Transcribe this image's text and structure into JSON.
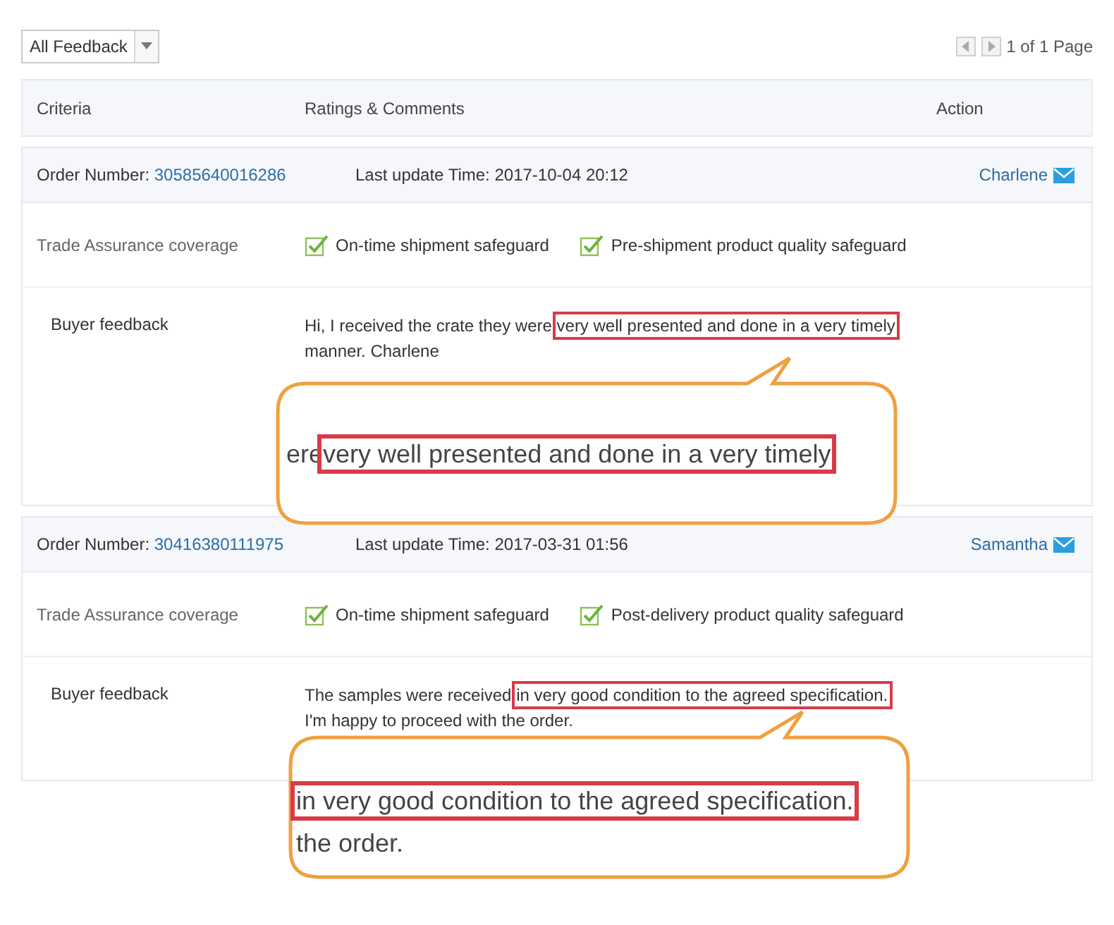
{
  "filter": {
    "label": "All Feedback"
  },
  "pager": {
    "text": "1 of 1 Page"
  },
  "table": {
    "columns": [
      "Criteria",
      "Ratings & Comments",
      "Action"
    ],
    "orders": [
      {
        "order_label": "Order Number:",
        "order_number": "30585640016286",
        "update_label": "Last update Time:",
        "update_time": "2017-10-04 20:12",
        "buyer": "Charlene",
        "coverage_label": "Trade Assurance coverage",
        "safeguards": [
          {
            "label": "On-time shipment safeguard",
            "checked": true
          },
          {
            "label": "Pre-shipment product quality safeguard",
            "checked": true
          }
        ],
        "feedback_label": "Buyer feedback",
        "feedback": {
          "before": "Hi, I received the crate  they were",
          "highlight": "very well presented and done in a very timely",
          "second_line": "manner. Charlene"
        }
      },
      {
        "order_label": "Order Number:",
        "order_number": "30416380111975",
        "update_label": "Last update Time:",
        "update_time": "2017-03-31 01:56",
        "buyer": "Samantha",
        "coverage_label": "Trade Assurance coverage",
        "safeguards": [
          {
            "label": "On-time shipment safeguard",
            "checked": true
          },
          {
            "label": "Post-delivery product quality safeguard",
            "checked": true
          }
        ],
        "feedback_label": "Buyer feedback",
        "feedback": {
          "before": "The samples were received",
          "highlight": "in very good condition to the agreed specification.",
          "second_line": "I'm happy to proceed with the order."
        }
      }
    ]
  },
  "callouts": [
    {
      "before": "ere",
      "highlight": "very well presented and done in a very timely"
    },
    {
      "highlight": "in very good condition to the agreed specification.",
      "second_line": "the order."
    }
  ]
}
